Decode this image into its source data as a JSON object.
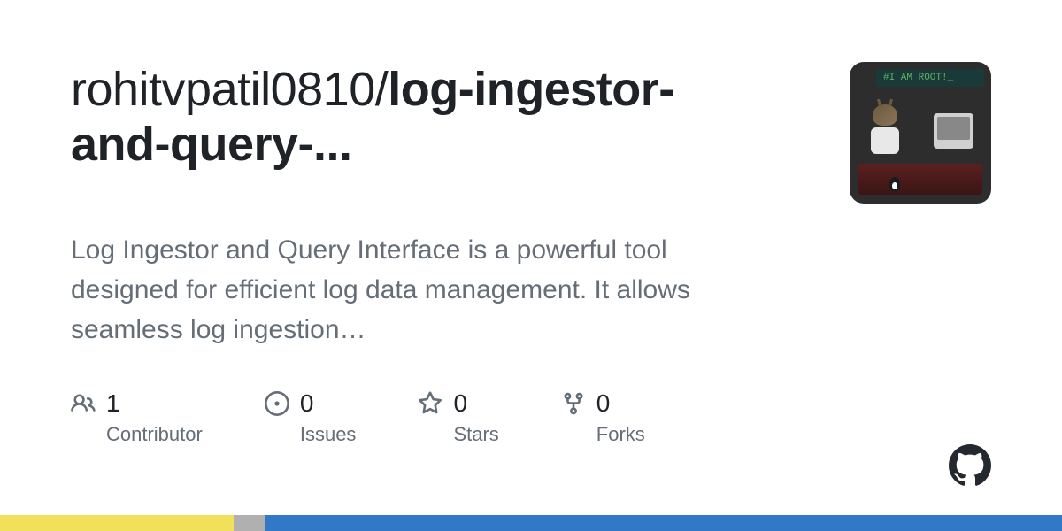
{
  "repo": {
    "owner": "rohitvpatil0810",
    "separator": "/",
    "name": "log-ingestor-and-query-..."
  },
  "description": "Log Ingestor and Query Interface is a powerful tool designed for efficient log data management. It allows seamless log ingestion…",
  "avatar": {
    "banner_text": "#I AM ROOT!_"
  },
  "stats": {
    "contributors": {
      "value": "1",
      "label": "Contributor"
    },
    "issues": {
      "value": "0",
      "label": "Issues"
    },
    "stars": {
      "value": "0",
      "label": "Stars"
    },
    "forks": {
      "value": "0",
      "label": "Forks"
    }
  }
}
